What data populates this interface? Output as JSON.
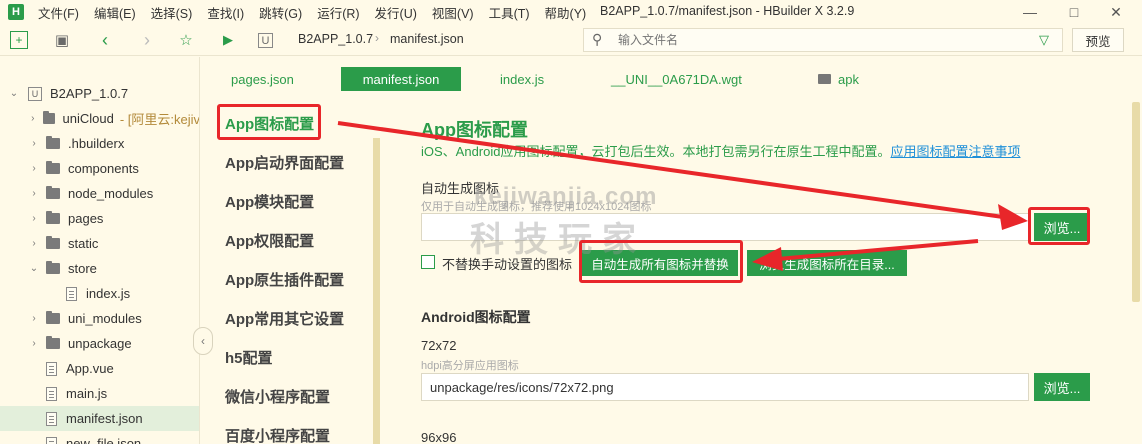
{
  "menubar": {
    "items": [
      "文件(F)",
      "编辑(E)",
      "选择(S)",
      "查找(I)",
      "跳转(G)",
      "运行(R)",
      "发行(U)",
      "视图(V)",
      "工具(T)",
      "帮助(Y)"
    ],
    "window_title": "B2APP_1.0.7/manifest.json - HBuilder X 3.2.9",
    "logo": "H"
  },
  "toolbar": {
    "breadcrumb": [
      "B2APP_1.0.7",
      "manifest.json"
    ],
    "file_search_placeholder": "输入文件名",
    "preview_label": "预览"
  },
  "sidebar": {
    "project": "B2APP_1.0.7",
    "project_icon": "U",
    "items": [
      {
        "label": "uniCloud",
        "extra": "- [阿里云:kejiv",
        "kind": "folder",
        "expanded": false
      },
      {
        "label": ".hbuilderx",
        "kind": "folder",
        "expanded": false
      },
      {
        "label": "components",
        "kind": "folder",
        "expanded": false
      },
      {
        "label": "node_modules",
        "kind": "folder",
        "expanded": false
      },
      {
        "label": "pages",
        "kind": "folder",
        "expanded": false
      },
      {
        "label": "static",
        "kind": "folder",
        "expanded": false
      },
      {
        "label": "store",
        "kind": "folder",
        "expanded": true
      },
      {
        "label": "index.js",
        "kind": "file",
        "indent": 1
      },
      {
        "label": "uni_modules",
        "kind": "folder",
        "expanded": false
      },
      {
        "label": "unpackage",
        "kind": "folder",
        "expanded": false
      },
      {
        "label": "App.vue",
        "kind": "file"
      },
      {
        "label": "main.js",
        "kind": "file"
      },
      {
        "label": "manifest.json",
        "kind": "file",
        "selected": true
      },
      {
        "label": "new_file.json",
        "kind": "file"
      }
    ]
  },
  "tabs": [
    "pages.json",
    "manifest.json",
    "index.js",
    "__UNI__0A671DA.wgt",
    "apk"
  ],
  "active_tab": "manifest.json",
  "config_nav": [
    "App图标配置",
    "App启动界面配置",
    "App模块配置",
    "App权限配置",
    "App原生插件配置",
    "App常用其它设置",
    "h5配置",
    "微信小程序配置",
    "百度小程序配置"
  ],
  "active_config": "App图标配置",
  "content": {
    "title": "App图标配置",
    "description": "iOS、Android应用图标配置，云打包后生效。本地打包需另行在原生工程中配置。",
    "description_link": "应用图标配置注意事项",
    "auto_label": "自动生成图标",
    "auto_hint": "仅用于自动生成图标，推荐使用1024x1024图标",
    "auto_input_value": "",
    "browse_label": "浏览...",
    "no_replace_label": "不替换手动设置的图标",
    "generate_button": "自动生成所有图标并替换",
    "open_dir_button": "浏览生成图标所在目录...",
    "android_title": "Android图标配置",
    "size_72_label": "72x72",
    "size_72_hint": "hdpi高分屏应用图标",
    "size_72_value": "unpackage/res/icons/72x72.png",
    "size_96_label": "96x96"
  },
  "watermark": {
    "en": "kejiwanjia.com",
    "cn": "科技玩家"
  },
  "colors": {
    "accent": "#2b9c4a",
    "background": "#fffae8",
    "annotation": "#e8262a",
    "link": "#1e8fd8"
  }
}
